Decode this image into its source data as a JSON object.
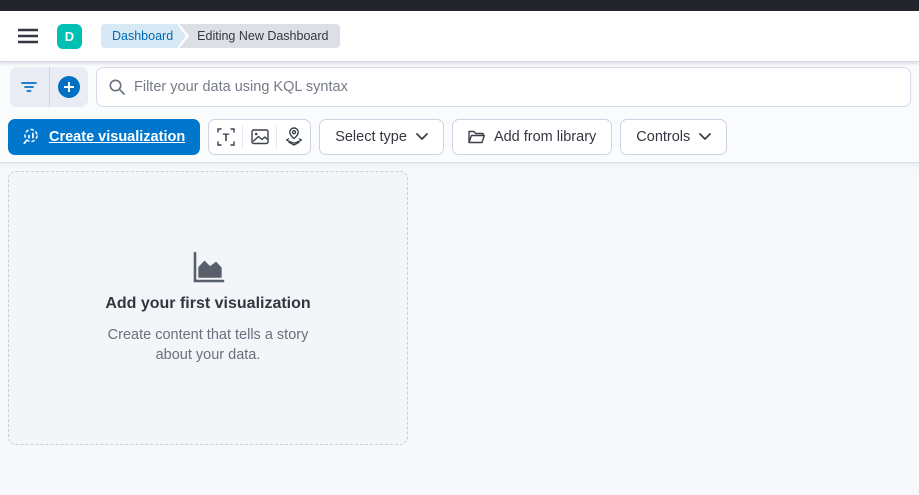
{
  "header": {
    "logo_letter": "D",
    "breadcrumbs": [
      {
        "label": "Dashboard"
      },
      {
        "label": "Editing New Dashboard"
      }
    ]
  },
  "query_bar": {
    "placeholder": "Filter your data using KQL syntax",
    "value": ""
  },
  "toolbar": {
    "create_visualization_label": "Create visualization",
    "select_type_label": "Select type",
    "add_from_library_label": "Add from library",
    "controls_label": "Controls"
  },
  "empty_state": {
    "title": "Add your first visualization",
    "description": "Create content that tells a story about your data."
  },
  "icons": {
    "menu": "hamburger",
    "filter": "funnel-lines",
    "add_filter": "plus-circle",
    "search": "magnifier",
    "create_visualization": "lens-chart",
    "text_glyph": "T",
    "image_element": "picture",
    "map_element": "map-pin-layers",
    "chevron": "chevron-down",
    "library": "folder-open",
    "empty_state": "area-chart"
  },
  "colors": {
    "primary": "#0077cc",
    "accent_blue": "#0071c2",
    "logo_teal": "#00bfb3",
    "topbar_dark": "#23252c",
    "breadcrumb_link_bg": "#d8e9f6",
    "breadcrumb_link_text": "#006bb4",
    "breadcrumb_current_bg": "#dcdfe6",
    "panel_dash_border": "#c8cfdb",
    "muted_text": "#69707d"
  }
}
